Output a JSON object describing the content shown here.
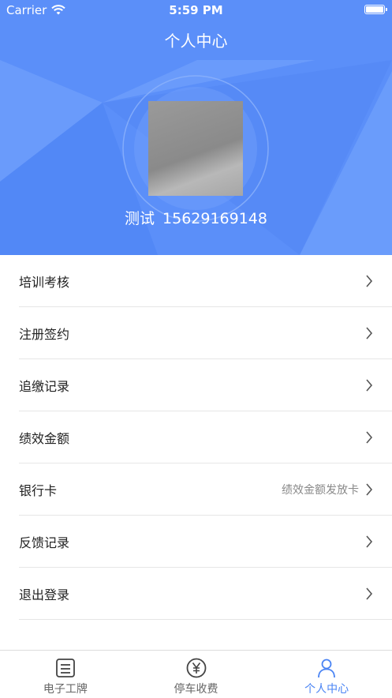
{
  "status_bar": {
    "carrier": "Carrier",
    "time": "5:59 PM"
  },
  "nav": {
    "title": "个人中心"
  },
  "profile": {
    "name": "测试",
    "phone": "15629169148"
  },
  "menu": [
    {
      "label": "培训考核",
      "detail": ""
    },
    {
      "label": "注册签约",
      "detail": ""
    },
    {
      "label": "追缴记录",
      "detail": ""
    },
    {
      "label": "绩效金额",
      "detail": ""
    },
    {
      "label": "银行卡",
      "detail": "绩效金额发放卡"
    },
    {
      "label": "反馈记录",
      "detail": ""
    },
    {
      "label": "退出登录",
      "detail": ""
    }
  ],
  "tabbar": {
    "tabs": [
      {
        "label": "电子工牌",
        "icon": "badge-icon",
        "active": false
      },
      {
        "label": "停车收费",
        "icon": "yen-coin-icon",
        "active": false
      },
      {
        "label": "个人中心",
        "icon": "person-icon",
        "active": true
      }
    ]
  },
  "colors": {
    "header": "#5b8ff9",
    "active_tab": "#4a84f4"
  }
}
